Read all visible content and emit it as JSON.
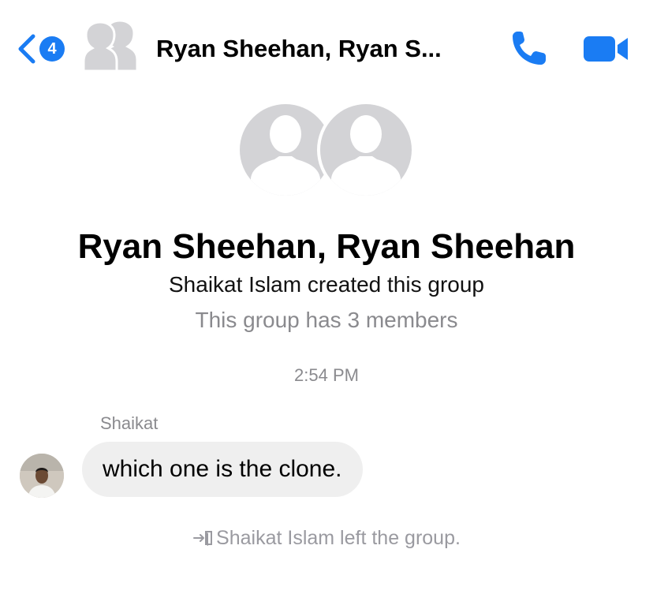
{
  "header": {
    "unread_count": "4",
    "title": "Ryan Sheehan, Ryan S..."
  },
  "group": {
    "name": "Ryan Sheehan, Ryan Sheehan",
    "created_text": "Shaikat Islam created this group",
    "members_text": "This group has 3 members"
  },
  "conversation": {
    "timestamp": "2:54 PM",
    "messages": [
      {
        "sender": "Shaikat",
        "text": "which one is the clone."
      }
    ],
    "notice": "Shaikat Islam left the group."
  },
  "icons": {
    "back": "chevron-left-icon",
    "call": "phone-icon",
    "video": "video-camera-icon",
    "left_group": "leave-group-icon"
  },
  "colors": {
    "accent": "#1a7cf3",
    "placeholder_avatar": "#d3d3d6",
    "bubble": "#efefef",
    "secondary_text": "#8a8a8e"
  }
}
